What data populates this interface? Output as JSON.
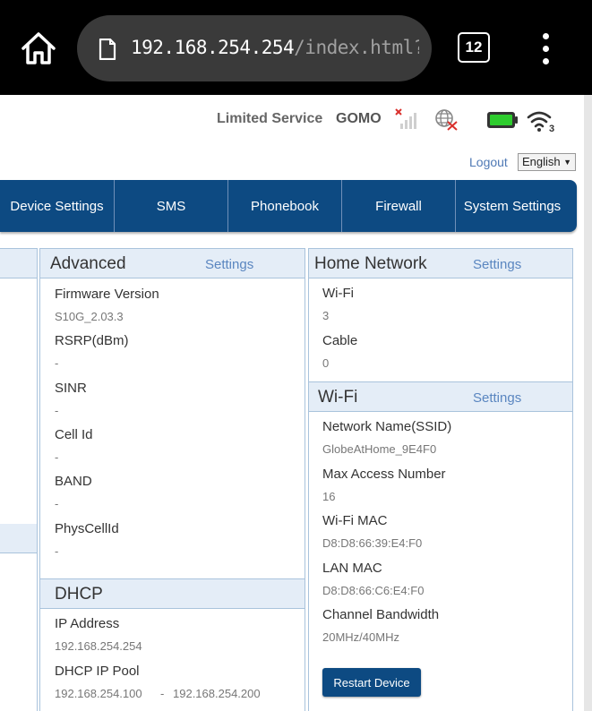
{
  "browser": {
    "url_host": "192.168.254.254",
    "url_path": "/index.html?t=",
    "tab_count": "12"
  },
  "status": {
    "service": "Limited Service",
    "carrier": "GOMO",
    "wifi_clients": "3",
    "battery_color": "#2ecc2e"
  },
  "header": {
    "logout": "Logout",
    "language": "English"
  },
  "nav": {
    "items": [
      {
        "label": "Device Settings"
      },
      {
        "label": "SMS"
      },
      {
        "label": "Phonebook"
      },
      {
        "label": "Firewall"
      },
      {
        "label": "System Settings"
      }
    ]
  },
  "advanced": {
    "title": "Advanced",
    "link": "Settings",
    "rows": [
      {
        "label": "Firmware Version",
        "value": "S10G_2.03.3"
      },
      {
        "label": "RSRP(dBm)",
        "value": "-"
      },
      {
        "label": "SINR",
        "value": "-"
      },
      {
        "label": "Cell Id",
        "value": "-"
      },
      {
        "label": "BAND",
        "value": "-"
      },
      {
        "label": "PhysCellId",
        "value": "-"
      }
    ]
  },
  "dhcp": {
    "title": "DHCP",
    "ip_label": "IP Address",
    "ip_value": "192.168.254.254",
    "pool_label": "DHCP IP Pool",
    "pool_start": "192.168.254.100",
    "pool_sep": "-",
    "pool_end": "192.168.254.200"
  },
  "home_network": {
    "title": "Home Network",
    "link": "Settings",
    "rows": [
      {
        "label": "Wi-Fi",
        "value": "3"
      },
      {
        "label": "Cable",
        "value": "0"
      }
    ]
  },
  "wifi": {
    "title": "Wi-Fi",
    "link": "Settings",
    "rows": [
      {
        "label": "Network Name(SSID)",
        "value": "GlobeAtHome_9E4F0"
      },
      {
        "label": "Max Access Number",
        "value": "16"
      },
      {
        "label": "Wi-Fi MAC",
        "value": "D8:D8:66:39:E4:F0"
      },
      {
        "label": "LAN MAC",
        "value": "D8:D8:66:C6:E4:F0"
      },
      {
        "label": "Channel Bandwidth",
        "value": "20MHz/40MHz"
      }
    ],
    "restart_label": "Restart Device"
  }
}
